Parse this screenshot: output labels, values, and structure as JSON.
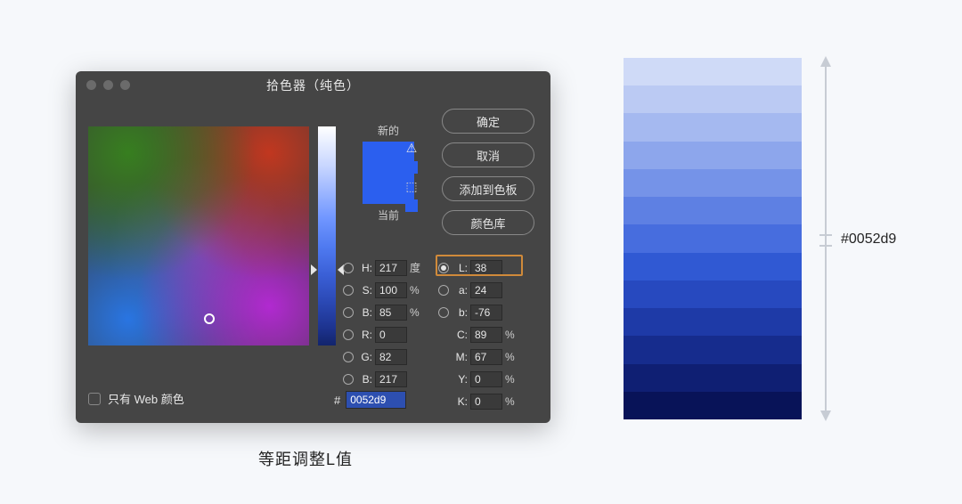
{
  "dialog": {
    "title": "拾色器（纯色）",
    "new_label": "新的",
    "current_label": "当前",
    "swatch_color": "#2b5fef",
    "buttons": {
      "ok": "确定",
      "cancel": "取消",
      "add_swatch": "添加到色板",
      "color_libs": "颜色库"
    },
    "fields": {
      "H": {
        "label": "H:",
        "value": "217",
        "unit": "度"
      },
      "S": {
        "label": "S:",
        "value": "100",
        "unit": "%"
      },
      "Bv": {
        "label": "B:",
        "value": "85",
        "unit": "%"
      },
      "R": {
        "label": "R:",
        "value": "0"
      },
      "G": {
        "label": "G:",
        "value": "82"
      },
      "Bc": {
        "label": "B:",
        "value": "217"
      },
      "L": {
        "label": "L:",
        "value": "38"
      },
      "a": {
        "label": "a:",
        "value": "24"
      },
      "b": {
        "label": "b:",
        "value": "-76"
      },
      "C": {
        "label": "C:",
        "value": "89",
        "unit": "%"
      },
      "M": {
        "label": "M:",
        "value": "67",
        "unit": "%"
      },
      "Y": {
        "label": "Y:",
        "value": "0",
        "unit": "%"
      },
      "K": {
        "label": "K:",
        "value": "0",
        "unit": "%"
      }
    },
    "hex": {
      "prefix": "#",
      "value": "0052d9"
    },
    "web_only": "只有 Web 颜色"
  },
  "ladder": {
    "steps": [
      "#cfdaf7",
      "#bbcaf3",
      "#a5b9f0",
      "#8da6ec",
      "#7593e8",
      "#5e80e3",
      "#476dde",
      "#3059d3",
      "#2749bf",
      "#1e3aa7",
      "#162c8d",
      "#0f1f73",
      "#081358"
    ],
    "label": "#0052d9"
  },
  "caption": "等距调整L值"
}
